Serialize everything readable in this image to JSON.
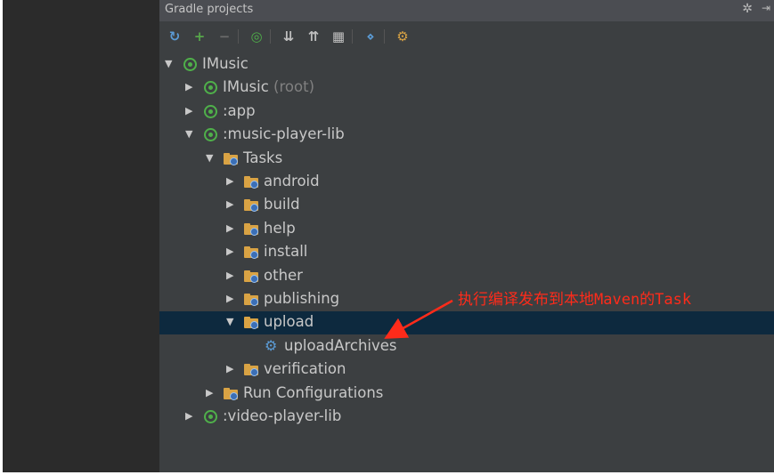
{
  "panel": {
    "title": "Gradle projects",
    "gear_glyph": "✲",
    "pin_glyph": "⇥"
  },
  "toolbar": [
    {
      "name": "refresh-all-icon",
      "glyph": "↻",
      "color": "#5b9bd5"
    },
    {
      "name": "add-project-icon",
      "glyph": "+",
      "color": "#57a64a"
    },
    {
      "name": "remove-project-icon",
      "glyph": "−",
      "color": "#6b6b6b"
    },
    {
      "name": "execute-task-icon",
      "glyph": "◎",
      "color": "#4fb04a"
    },
    {
      "name": "expand-all-icon",
      "glyph": "⇊",
      "color": "#bfbfbf"
    },
    {
      "name": "collapse-all-icon",
      "glyph": "⇈",
      "color": "#bfbfbf"
    },
    {
      "name": "group-tasks-icon",
      "glyph": "▦",
      "color": "#bfbfbf"
    },
    {
      "name": "toggle-offline-icon",
      "glyph": "⋄",
      "color": "#5b9bd5"
    },
    {
      "name": "gradle-settings-icon",
      "glyph": "⚙",
      "color": "#d9a344"
    }
  ],
  "tree": [
    {
      "label": "IMusic",
      "suffix": "",
      "icon": "gradle",
      "arrow": "▼",
      "indent": 0
    },
    {
      "label": "IMusic",
      "suffix": " (root)",
      "icon": "gradle",
      "arrow": "▶",
      "indent": 1
    },
    {
      "label": ":app",
      "suffix": "",
      "icon": "gradle",
      "arrow": "▶",
      "indent": 1
    },
    {
      "label": ":music-player-lib",
      "suffix": "",
      "icon": "gradle",
      "arrow": "▼",
      "indent": 1
    },
    {
      "label": "Tasks",
      "suffix": "",
      "icon": "folder",
      "arrow": "▼",
      "indent": 2
    },
    {
      "label": "android",
      "suffix": "",
      "icon": "folder",
      "arrow": "▶",
      "indent": 3
    },
    {
      "label": "build",
      "suffix": "",
      "icon": "folder",
      "arrow": "▶",
      "indent": 3
    },
    {
      "label": "help",
      "suffix": "",
      "icon": "folder",
      "arrow": "▶",
      "indent": 3
    },
    {
      "label": "install",
      "suffix": "",
      "icon": "folder",
      "arrow": "▶",
      "indent": 3
    },
    {
      "label": "other",
      "suffix": "",
      "icon": "folder",
      "arrow": "▶",
      "indent": 3
    },
    {
      "label": "publishing",
      "suffix": "",
      "icon": "folder",
      "arrow": "▶",
      "indent": 3
    },
    {
      "label": "upload",
      "suffix": "",
      "icon": "folder",
      "arrow": "▼",
      "indent": 3,
      "selected": true
    },
    {
      "label": "uploadArchives",
      "suffix": "",
      "icon": "cog",
      "arrow": "",
      "indent": 4
    },
    {
      "label": "verification",
      "suffix": "",
      "icon": "folder",
      "arrow": "▶",
      "indent": 3
    },
    {
      "label": "Run Configurations",
      "suffix": "",
      "icon": "folder",
      "arrow": "▶",
      "indent": 2
    },
    {
      "label": ":video-player-lib",
      "suffix": "",
      "icon": "gradle",
      "arrow": "▶",
      "indent": 1
    }
  ],
  "annotation": {
    "text": "执行编译发布到本地Maven的Task",
    "color": "#ff2b1a"
  }
}
